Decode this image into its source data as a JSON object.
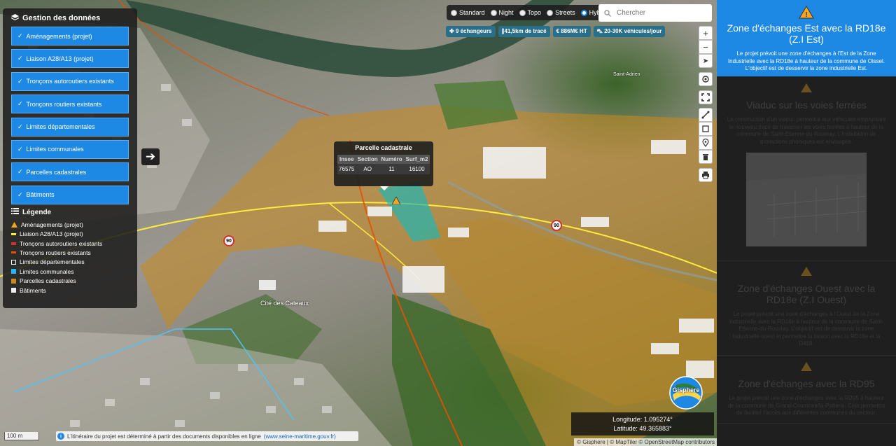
{
  "layers_panel": {
    "title": "Gestion des données",
    "items": [
      {
        "label": "Aménagements (projet)"
      },
      {
        "label": "Liaison A28/A13 (projet)"
      },
      {
        "label": "Tronçons autoroutiers existants"
      },
      {
        "label": "Tronçons routiers existants"
      },
      {
        "label": "Limites départementales"
      },
      {
        "label": "Limites communales"
      },
      {
        "label": "Parcelles cadastrales"
      },
      {
        "label": "Bâtiments"
      }
    ],
    "check": "✓"
  },
  "legend": {
    "title": "Légende",
    "items": [
      {
        "label": "Aménagements (projet)",
        "color": "#f5a623",
        "icon": "warning-icon"
      },
      {
        "label": "Liaison A28/A13 (projet)",
        "color": "#ffeb3b"
      },
      {
        "label": "Tronçons autoroutiers existants",
        "color": "#d32f2f"
      },
      {
        "label": "Tronçons routiers existants",
        "color": "#e65100"
      },
      {
        "label": "Limites départementales",
        "color": "#ffffff"
      },
      {
        "label": "Limites communales",
        "color": "#29b6f6"
      },
      {
        "label": "Parcelles cadastrales",
        "color": "#c8891e"
      },
      {
        "label": "Bâtiments",
        "color": "#eeeeee"
      }
    ]
  },
  "basemaps": {
    "options": [
      "Standard",
      "Night",
      "Topo",
      "Streets",
      "Hybrid"
    ],
    "selected": "Hybrid"
  },
  "search": {
    "placeholder": "Chercher"
  },
  "badges": [
    {
      "label": "✤ 9 échangeurs"
    },
    {
      "label": "∥41,5km de tracé"
    },
    {
      "label": "€ 886M€ HT"
    },
    {
      "label": "⛍ 20-30K véhicules/jour"
    }
  ],
  "popup": {
    "title": "Parcelle cadastrale",
    "columns": [
      "Insee",
      "Section",
      "Numéro",
      "Surf_m2"
    ],
    "row": [
      "76575",
      "AO",
      "11",
      "16100"
    ]
  },
  "speed_limits": [
    "90",
    "90"
  ],
  "map_labels": {
    "city": "Cité des Cateaux",
    "town": "Saint-Adrien"
  },
  "coordinates": {
    "longitude": "Longitude: 1.095274°",
    "latitude": "Latitude: 49.365883°"
  },
  "scale": "100 m",
  "banner": {
    "text": "L'itinéraire du projet est déterminé à partir des documents disponibles en ligne",
    "link": "(www.seine-maritime.gouv.fr)"
  },
  "attribution": "© Gisphere | © MapTiler © OpenStreetMap contributors",
  "logo_text": "Gisphere",
  "sidebar": {
    "cards": [
      {
        "title": "Zone d'échanges Est avec la RD18e (Z.I Est)",
        "text": "Le projet prévoit une zone d'échanges à l'Est de la Zone Industrielle avec la RD18e à hauteur de la commune de Oissel. L'objectif est de desservir la zone industrielle Est."
      },
      {
        "title": "Viaduc sur les voies ferrées",
        "text": "La construction d'un viaduc permettra aux véhicules empruntant le nouveau tracé de traverser les voies ferrées à hauteur de la commune de Saint-Etienne-du-Rouvray. L'installation de protections phoniques est envisagée."
      },
      {
        "title": "Zone d'échanges Ouest avec la RD18e (Z.I Ouest)",
        "text": "Le projet prévoit une zone d'échanges à l'Ouest de la Zone Industrielle avec la RD18e à hauteur de la commune de Saint-Etienne-du-Rouvray. L'objectif est de desservir la zone industrielle ouest et permettre la liaison avec la RD18e et la D418."
      },
      {
        "title": "Zone d'échanges avec la RD95",
        "text": "Le projet prévoit une zone d'échanges avec la RD95 à hauteur de la commune de Grand-Couronne/la-Potterie. Cela permettra de faciliter l'accès aux différentes communes du secteur."
      }
    ]
  }
}
